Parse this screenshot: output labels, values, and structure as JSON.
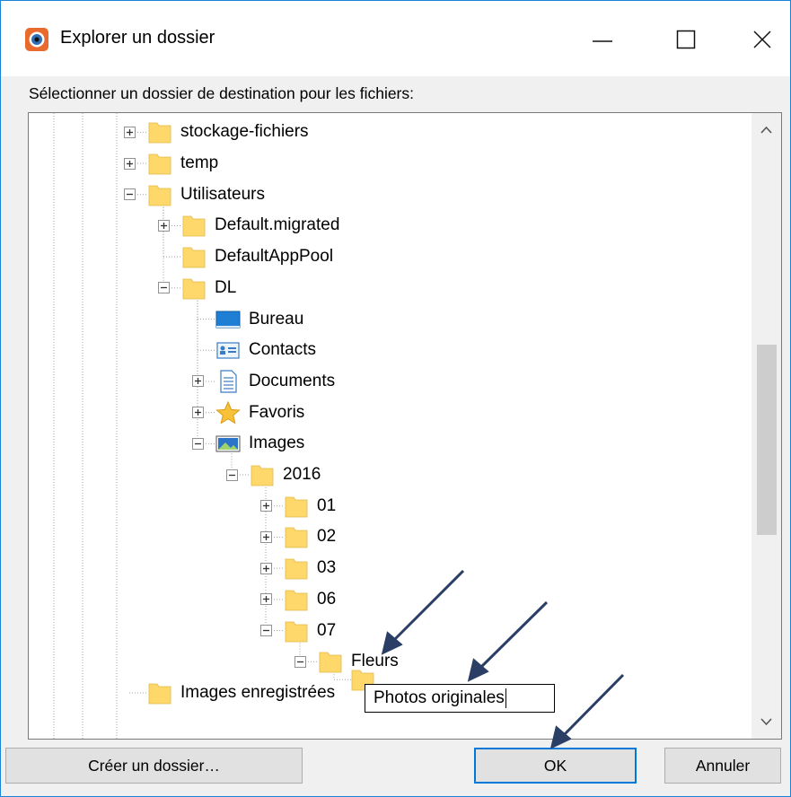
{
  "window": {
    "title": "Explorer un dossier",
    "controls": {
      "minimize": "—",
      "maximize": "☐",
      "close": "✕"
    }
  },
  "prompt": "Sélectionner un dossier de destination pour les fichiers:",
  "tree": {
    "items": [
      {
        "label": "stockage-fichiers",
        "icon": "folder-icon",
        "expander": "plus"
      },
      {
        "label": "temp",
        "icon": "folder-icon",
        "expander": "plus"
      },
      {
        "label": "Utilisateurs",
        "icon": "folder-icon",
        "expander": "minus"
      },
      {
        "label": "Default.migrated",
        "icon": "folder-icon",
        "expander": "plus"
      },
      {
        "label": "DefaultAppPool",
        "icon": "folder-icon",
        "expander": "none"
      },
      {
        "label": "DL",
        "icon": "folder-icon",
        "expander": "minus"
      },
      {
        "label": "Bureau",
        "icon": "desktop-icon",
        "expander": "none"
      },
      {
        "label": "Contacts",
        "icon": "contacts-icon",
        "expander": "none"
      },
      {
        "label": "Documents",
        "icon": "documents-icon",
        "expander": "plus"
      },
      {
        "label": "Favoris",
        "icon": "star-icon",
        "expander": "plus"
      },
      {
        "label": "Images",
        "icon": "pictures-icon",
        "expander": "minus"
      },
      {
        "label": "2016",
        "icon": "folder-icon",
        "expander": "minus"
      },
      {
        "label": "01",
        "icon": "folder-icon",
        "expander": "plus"
      },
      {
        "label": "02",
        "icon": "folder-icon",
        "expander": "plus"
      },
      {
        "label": "03",
        "icon": "folder-icon",
        "expander": "plus"
      },
      {
        "label": "06",
        "icon": "folder-icon",
        "expander": "plus"
      },
      {
        "label": "07",
        "icon": "folder-icon",
        "expander": "minus"
      },
      {
        "label": "Fleurs",
        "icon": "folder-icon",
        "expander": "minus"
      },
      {
        "label": "Images enregistrées",
        "icon": "folder-icon",
        "expander": "none"
      }
    ],
    "rename_value": "Photos originales"
  },
  "buttons": {
    "create": "Créer un dossier…",
    "ok": "OK",
    "cancel": "Annuler"
  },
  "colors": {
    "accent": "#0078d7",
    "folder": "#ffd86b",
    "annotation_arrow": "#2b3e66"
  }
}
